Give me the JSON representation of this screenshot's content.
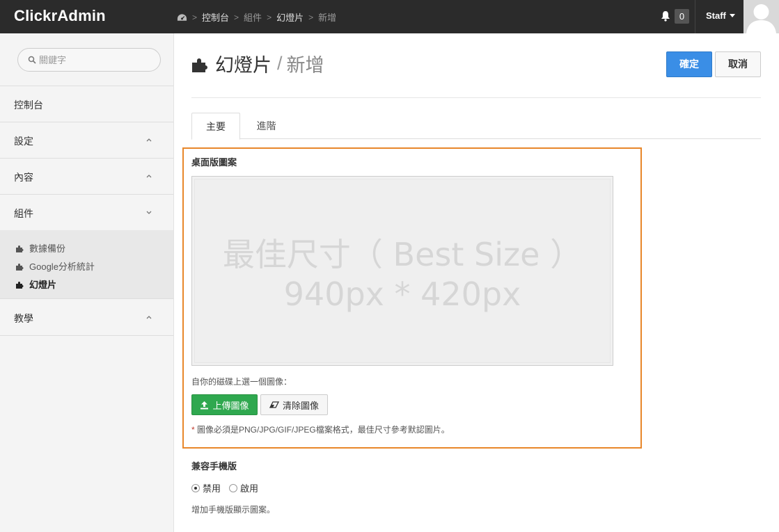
{
  "app": {
    "brand": "ClickrAdmin"
  },
  "breadcrumb": [
    "控制台",
    "組件",
    "幻燈片",
    "新增"
  ],
  "header": {
    "notification_count": "0",
    "user": "Staff"
  },
  "sidebar": {
    "search_placeholder": "關鍵字",
    "items": [
      {
        "label": "控制台"
      },
      {
        "label": "設定"
      },
      {
        "label": "內容"
      },
      {
        "label": "組件"
      },
      {
        "label": "教學"
      }
    ],
    "sub_items": [
      {
        "label": "數據備份"
      },
      {
        "label": "Google分析統計"
      },
      {
        "label": "幻燈片"
      }
    ]
  },
  "page": {
    "title": "幻燈片",
    "subtitle": "新增",
    "confirm_label": "確定",
    "cancel_label": "取消",
    "tabs": [
      {
        "label": "主要"
      },
      {
        "label": "進階"
      }
    ]
  },
  "desktop_pattern": {
    "label": "桌面版圖案",
    "placeholder_line1": "最佳尺寸（ Best Size ）",
    "placeholder_line2": "940px * 420px",
    "hint": "自你的磁碟上選一個圖像：",
    "upload_label": "上傳圖像",
    "clear_label": "清除圖像",
    "note_star": "*",
    "note": "圖像必須是PNG/JPG/GIF/JPEG檔案格式，最佳尺寸參考默認圖片。"
  },
  "mobile": {
    "label": "兼容手機版",
    "options": [
      "禁用",
      "啟用"
    ],
    "selected": "禁用",
    "hint": "增加手機版顯示圖案。"
  },
  "colors": {
    "topbar": "#2b2b2b",
    "primary": "#3a8ee6",
    "success": "#2fa84f",
    "highlight": "#e8872a"
  }
}
